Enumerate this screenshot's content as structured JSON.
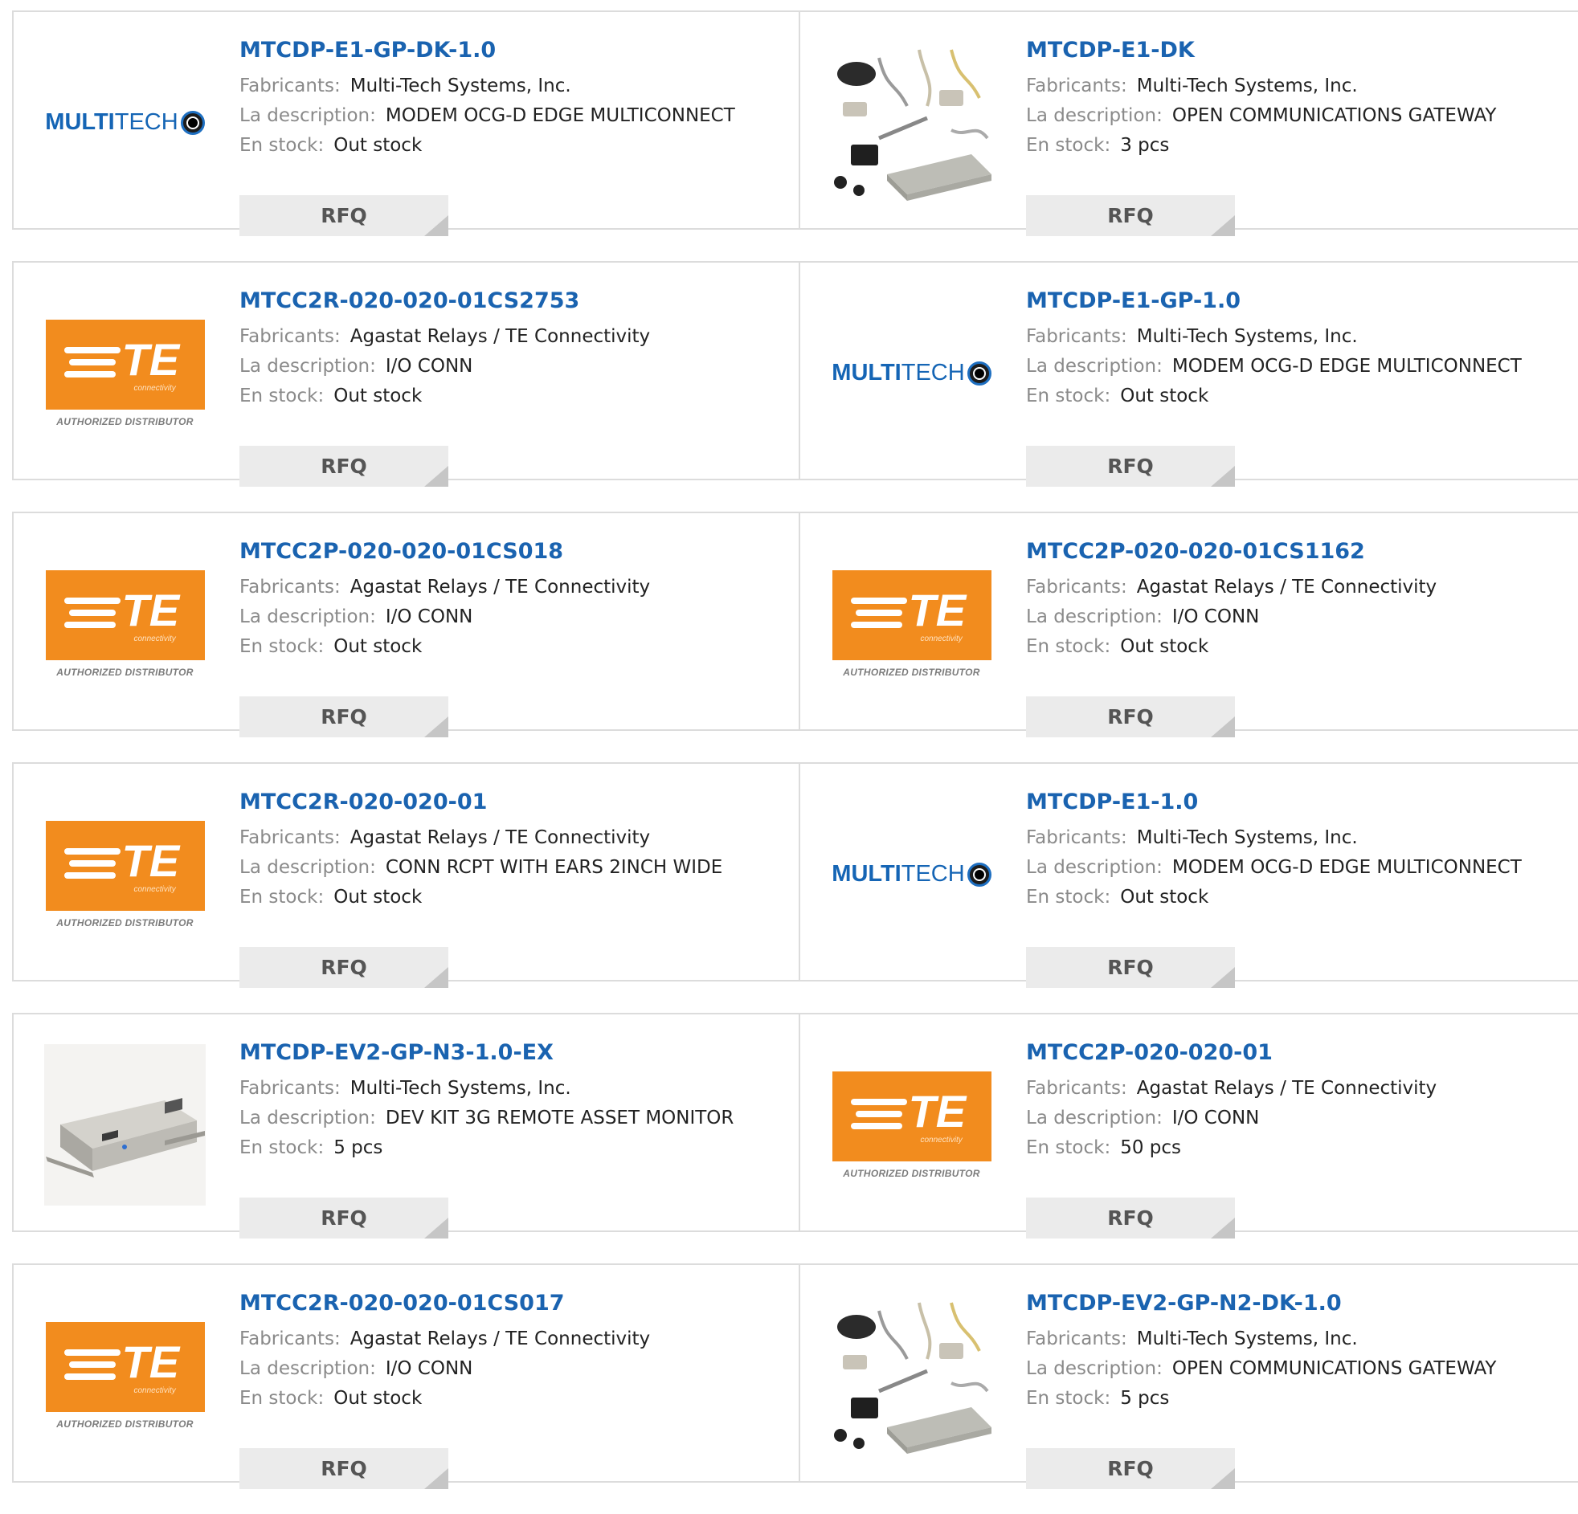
{
  "labels": {
    "manufacturer": "Fabricants:",
    "description": "La description:",
    "stock": "En stock:",
    "rfq": "RFQ"
  },
  "logo_text": {
    "multitech_bold": "MULTI",
    "multitech_light": "TECH",
    "te": "TE",
    "te_sub": "connectivity",
    "te_badge": "AUTHORIZED DISTRIBUTOR"
  },
  "colors": {
    "link": "#1a63b0",
    "te_orange": "#f28c1e",
    "multitech_blue": "#1565b5",
    "button_bg": "#ebebeb"
  },
  "products": [
    {
      "part": "MTCDP-E1-GP-DK-1.0",
      "manufacturer": "Multi-Tech Systems, Inc.",
      "description": "MODEM OCG-D EDGE MULTICONNECT",
      "stock": "Out stock",
      "image": "multitech-logo"
    },
    {
      "part": "MTCDP-E1-DK",
      "manufacturer": "Multi-Tech Systems, Inc.",
      "description": "OPEN COMMUNICATIONS GATEWAY",
      "stock": "3 pcs",
      "image": "dev-kit-photo"
    },
    {
      "part": "MTCC2R-020-020-01CS2753",
      "manufacturer": "Agastat Relays / TE Connectivity",
      "description": "I/O CONN",
      "stock": "Out stock",
      "image": "te-logo"
    },
    {
      "part": "MTCDP-E1-GP-1.0",
      "manufacturer": "Multi-Tech Systems, Inc.",
      "description": "MODEM OCG-D EDGE MULTICONNECT",
      "stock": "Out stock",
      "image": "multitech-logo"
    },
    {
      "part": "MTCC2P-020-020-01CS018",
      "manufacturer": "Agastat Relays / TE Connectivity",
      "description": "I/O CONN",
      "stock": "Out stock",
      "image": "te-logo"
    },
    {
      "part": "MTCC2P-020-020-01CS1162",
      "manufacturer": "Agastat Relays / TE Connectivity",
      "description": "I/O CONN",
      "stock": "Out stock",
      "image": "te-logo"
    },
    {
      "part": "MTCC2R-020-020-01",
      "manufacturer": "Agastat Relays / TE Connectivity",
      "description": "CONN RCPT WITH EARS 2INCH WIDE",
      "stock": "Out stock",
      "image": "te-logo"
    },
    {
      "part": "MTCDP-E1-1.0",
      "manufacturer": "Multi-Tech Systems, Inc.",
      "description": "MODEM OCG-D EDGE MULTICONNECT",
      "stock": "Out stock",
      "image": "multitech-logo"
    },
    {
      "part": "MTCDP-EV2-GP-N3-1.0-EX",
      "manufacturer": "Multi-Tech Systems, Inc.",
      "description": "DEV KIT 3G REMOTE ASSET MONITOR",
      "stock": "5 pcs",
      "image": "device-photo"
    },
    {
      "part": "MTCC2P-020-020-01",
      "manufacturer": "Agastat Relays / TE Connectivity",
      "description": "I/O CONN",
      "stock": "50 pcs",
      "image": "te-logo"
    },
    {
      "part": "MTCC2R-020-020-01CS017",
      "manufacturer": "Agastat Relays / TE Connectivity",
      "description": "I/O CONN",
      "stock": "Out stock",
      "image": "te-logo"
    },
    {
      "part": "MTCDP-EV2-GP-N2-DK-1.0",
      "manufacturer": "Multi-Tech Systems, Inc.",
      "description": "OPEN COMMUNICATIONS GATEWAY",
      "stock": "5 pcs",
      "image": "dev-kit-photo"
    }
  ]
}
